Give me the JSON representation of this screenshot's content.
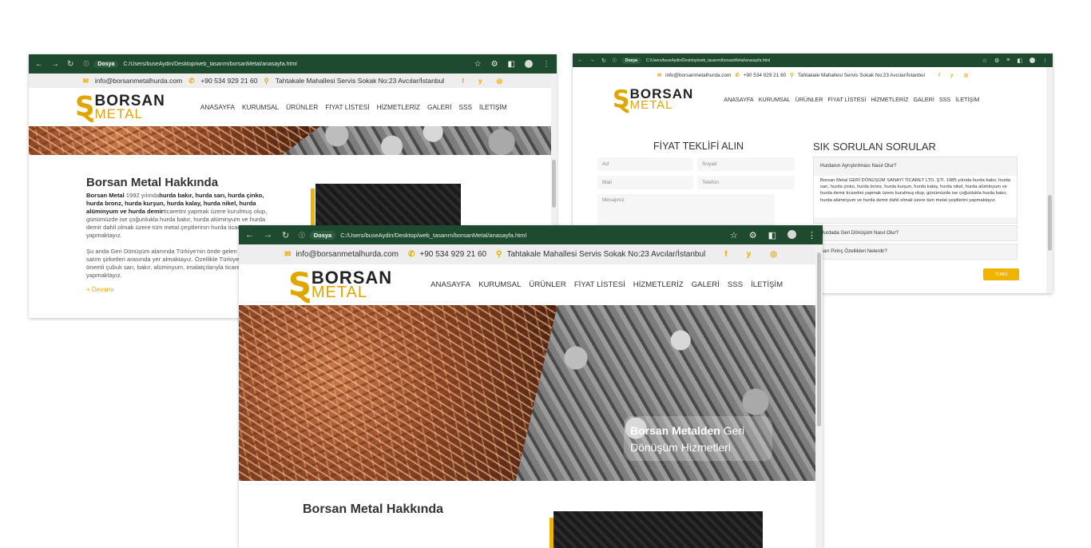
{
  "browser": {
    "dosya_label": "Dosya",
    "url": "C:/Users/buseAydin/Desktop/web_tasarım/borsanMetal/anasayfa.html"
  },
  "topbar": {
    "email": "info@borsanmetalhurda.com",
    "phone": "+90 534 929 21 60",
    "address": "Tahtakale Mahallesi Servis Sokak No:23 Avcılar/İstanbul",
    "social": [
      "f",
      "y",
      "◎"
    ]
  },
  "logo": {
    "line1": "BORSAN",
    "line2": "METAL"
  },
  "menu": [
    "ANASAYFA",
    "KURUMSAL",
    "ÜRÜNLER",
    "FİYAT LİSTESİ",
    "HİZMETLERİZ",
    "GALERİ",
    "SSS",
    "İLETİŞİM"
  ],
  "hero": {
    "highlight": "Borsan Metalden",
    "rest": " Geri Dönüşüm Hizmetleri"
  },
  "about": {
    "title": "Borsan Metal Hakkında",
    "p1_b1": "Borsan Metal",
    "p1_t1": " 1992 yılında",
    "p1_b2": "hurda bakır, hurda sarı, hurda çinko, hurda bronz, hurda kurşun, hurda kalay, hurda nikel, hurda alüminyum ve hurda demir",
    "p1_t2": "ticaretini yapmak üzere kurulmuş olup, günümüzde ise çoğunlukla hurda bakır, hurda alüminyum ve hurda demir dahil olmak üzere tüm metal çeşitlerinin hurda ticaretini yapmaktayız.",
    "p2": "Şu anda Geri Dönüşüm alanında Türkiye'nin önde gelen hurda alım satım şirketleri arasında yer almaktayız. Özellikle Türkiye'deki en önemli çubuk sarı, bakır, alüminyum, imalatçılarıyla ticaret yapmaktayız.",
    "more": "+ Devamı"
  },
  "quote_form": {
    "title": "FİYAT TEKLİFİ ALIN",
    "ad": "Ad",
    "soyad": "Soyad",
    "mail": "Mail",
    "telefon": "Telefon",
    "mesaj": "Mesajınız"
  },
  "faq": {
    "title": "SIK SORULAN SORULAR",
    "q1": "Hurdanın Ayrıştırılması Nasıl Olur?",
    "a1": "Borsan Metal GERİ DÖNÜŞÜM SANAYİ TİCARET LTD. ŞTİ. 1985 yılında hurda bakır, hurda sarı, hurda çinko, hurda bronz, hurda kurşun, hurda kalay, hurda nikel, hurda alüminyum ve hurda demir ticaretini yapmak üzere kurulmuş olup, günümüzde ise çoğunlukla hurda bakır, hurda alüminyum ve hurda demir dahil olmak üzere tüm metal çeşitlerini yapmaktayız.",
    "q2": "Hurdada Geri Dönüşüm Nasıl Olur?",
    "q3": "Sarı Pirinç Özellikleri Nelerdir?",
    "all_button": "TÜMÜ"
  },
  "colors": {
    "chrome": "#1e4a2f",
    "accent": "#e1a500",
    "topbar": "#eeeeee"
  }
}
